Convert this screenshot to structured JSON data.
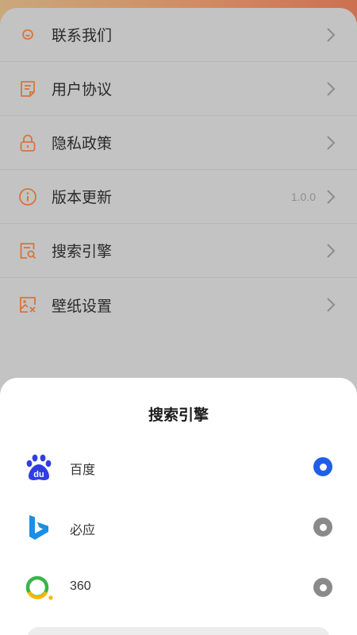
{
  "colors": {
    "accent_orange": "#d9743b",
    "radio_selected": "#1f5fe8",
    "radio_unselected": "#8a8a8a",
    "baidu_blue": "#2f3ee0",
    "bing_blue": "#1b8fe6",
    "ring_green": "#39b54a",
    "ring_yellow": "#f5b800"
  },
  "menu": {
    "items": [
      {
        "label": "联系我们",
        "icon": "chat-bubble-icon"
      },
      {
        "label": "用户协议",
        "icon": "document-icon"
      },
      {
        "label": "隐私政策",
        "icon": "lock-icon"
      },
      {
        "label": "版本更新",
        "icon": "info-icon",
        "value": "1.0.0"
      },
      {
        "label": "搜索引擎",
        "icon": "search-document-icon"
      },
      {
        "label": "壁纸设置",
        "icon": "wallpaper-icon"
      }
    ],
    "chevron_icon": "chevron-right-icon"
  },
  "sheet": {
    "title": "搜索引擎",
    "engines": [
      {
        "label": "百度",
        "icon": "baidu-paw-icon",
        "selected": true
      },
      {
        "label": "必应",
        "icon": "bing-logo-icon",
        "selected": false
      },
      {
        "label": "360",
        "icon": "ring-360-icon",
        "selected": false
      }
    ]
  }
}
